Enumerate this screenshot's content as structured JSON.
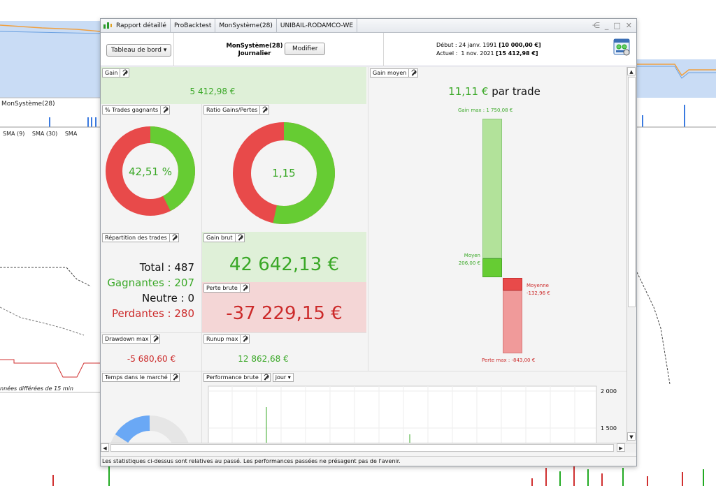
{
  "background": {
    "system_label": "MonSystème(28)",
    "indicators": [
      "SMA (9)",
      "SMA (30)",
      "SMA"
    ],
    "data_note": "nnées différées de 15 min"
  },
  "titlebar": {
    "tabs": [
      "Rapport détaillé",
      "ProBacktest",
      "MonSystème(28)",
      "UNIBAIL-RODAMCO-WE"
    ]
  },
  "header": {
    "dashboard_button": "Tableau de bord",
    "system_name": "MonSystème(28)",
    "period": "Journalier",
    "modify_button": "Modifier",
    "start_label": "Début :",
    "start_date": "24 janv. 1991",
    "start_value": "[10 000,00 €]",
    "current_label": "Actuel :",
    "current_date": "1 nov. 2021",
    "current_value": "[15 412,98 €]"
  },
  "stats": {
    "gain": {
      "label": "Gain",
      "value": "5 412,98 €"
    },
    "win_rate": {
      "label": "% Trades gagnants",
      "value": "42,51 %",
      "fraction": 0.4251
    },
    "ratio": {
      "label": "Ratio Gains/Pertes",
      "value": "1,15",
      "fraction": 0.534
    },
    "repartition": {
      "label": "Répartition des trades",
      "total": "Total : 487",
      "winners": "Gagnantes : 207",
      "neutral": "Neutre : 0",
      "losers": "Perdantes : 280"
    },
    "gross_gain": {
      "label": "Gain brut",
      "value": "42 642,13 €"
    },
    "gross_loss": {
      "label": "Perte brute",
      "value": "-37 229,15 €"
    },
    "drawdown": {
      "label": "Drawdown max",
      "value": "-5 680,60 €"
    },
    "runup": {
      "label": "Runup max",
      "value": "12 862,68 €"
    },
    "avg_gain": {
      "label": "Gain moyen",
      "value": "11,11 €",
      "unit": "par trade",
      "max_gain_label": "Gain max : 1 750,08 €",
      "avg_label": "Moyen",
      "avg_value": "206,00 €",
      "avg_loss_label": "Moyenne",
      "avg_loss_value": "-132,96 €",
      "max_loss_label": "Perte max : -843,00 €"
    },
    "time_in_market": {
      "label": "Temps dans le marché"
    },
    "performance": {
      "label": "Performance brute",
      "period": "jour",
      "ticks": [
        "2 000",
        "1 500"
      ]
    }
  },
  "footer": "Les statistiques ci-dessus sont relatives au passé. Les performances passées ne présagent pas de l'avenir.",
  "colors": {
    "green": "#66cc33",
    "red": "#e84a4a",
    "gain_bg": "#dff0d8",
    "loss_bg": "#f4d6d6"
  }
}
